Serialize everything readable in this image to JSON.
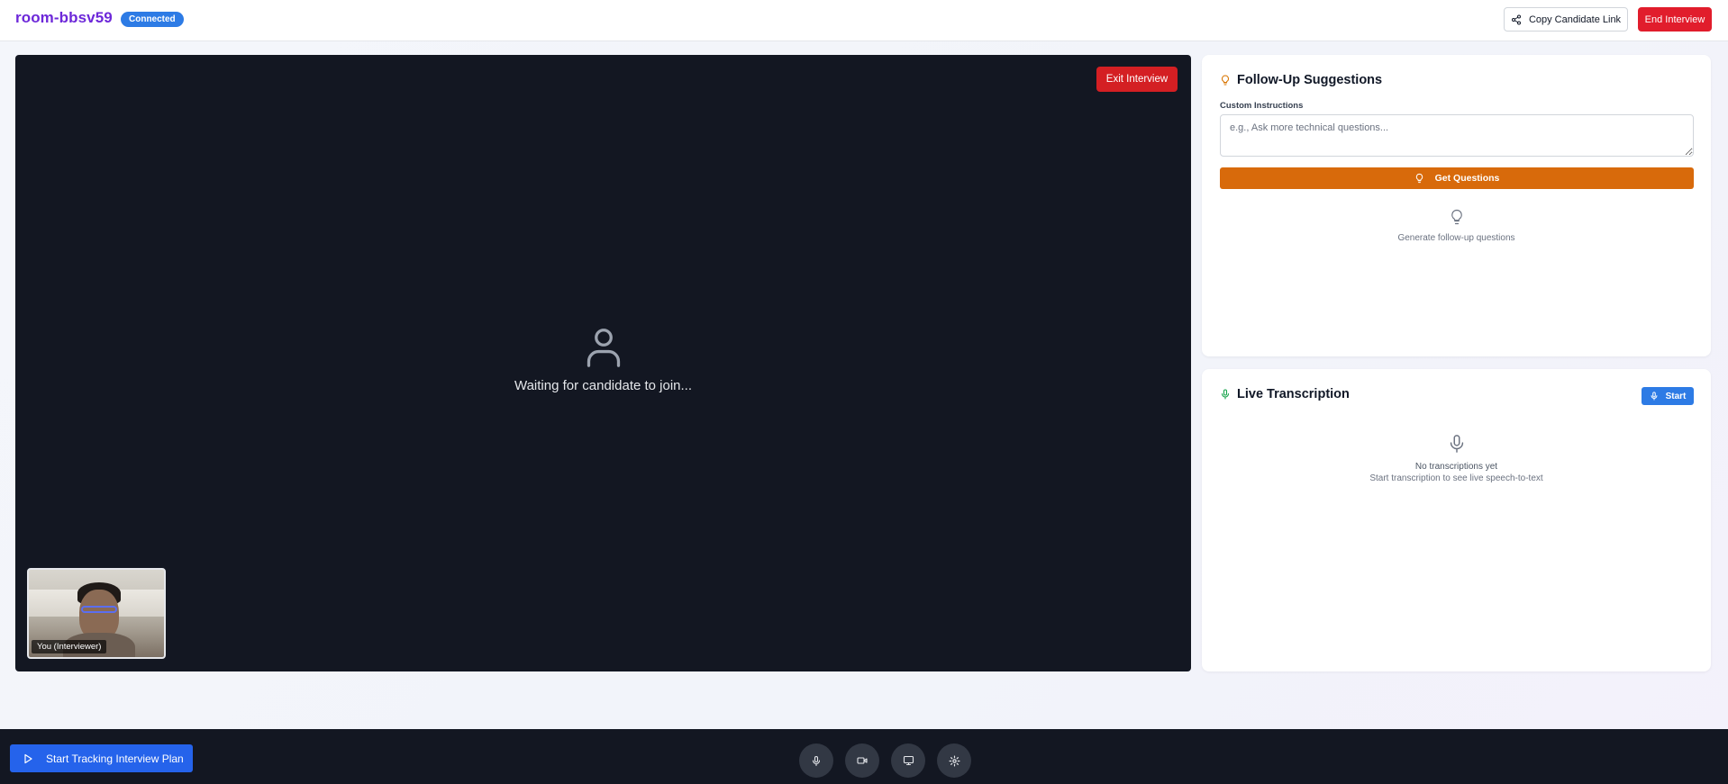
{
  "header": {
    "room_name": "room-bbsv59",
    "status_badge": "Connected",
    "copy_link_label": "Copy Candidate Link",
    "end_label": "End Interview"
  },
  "stage": {
    "exit_label": "Exit Interview",
    "waiting_text": "Waiting for candidate to join...",
    "self_label": "You (Interviewer)"
  },
  "followup": {
    "title": "Follow-Up Suggestions",
    "field_label": "Custom Instructions",
    "placeholder": "e.g., Ask more technical questions...",
    "button_label": "Get Questions",
    "empty_text": "Generate follow-up questions",
    "accent": "#d86a0b"
  },
  "transcription": {
    "title": "Live Transcription",
    "start_label": "Start",
    "empty_title": "No transcriptions yet",
    "empty_subtitle": "Start transcription to see live speech-to-text",
    "accent": "#16a34a"
  },
  "bottombar": {
    "track_label": "Start Tracking Interview Plan",
    "controls": [
      "microphone-icon",
      "video-camera-icon",
      "screen-share-icon",
      "settings-icon"
    ]
  },
  "colors": {
    "brand": "#6d28d9",
    "primary": "#2d7be5",
    "danger": "#e11d2c",
    "stage_bg": "#131722"
  }
}
